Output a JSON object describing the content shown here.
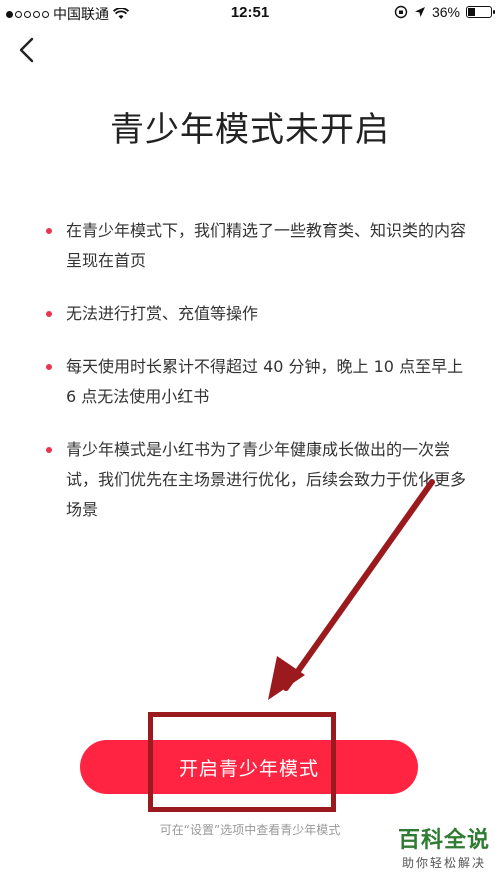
{
  "status_bar": {
    "carrier": "中国联通",
    "time": "12:51",
    "battery": "36%",
    "battery_level": 0.36
  },
  "nav": {
    "back_icon": "chevron-left-icon"
  },
  "title": "青少年模式未开启",
  "info_items": [
    {
      "text": "在青少年模式下，我们精选了一些教育类、知识类的内容呈现在首页"
    },
    {
      "text": "无法进行打赏、充值等操作"
    },
    {
      "text": "每天使用时长累计不得超过 40 分钟，晚上 10 点至早上 6 点无法使用小红书"
    },
    {
      "text": "青少年模式是小红书为了青少年健康成长做出的一次尝试，我们优先在主场景进行优化，后续会致力于优化更多场景"
    }
  ],
  "primary_button": {
    "label": "开启青少年模式"
  },
  "settings_hint": "可在“设置”选项中查看青少年模式",
  "watermark": {
    "main": "百科全说",
    "sub": "助你轻松解决"
  },
  "colors": {
    "accent": "#ff2442",
    "bullet": "#e8374c",
    "annotation": "#9b1a1e"
  }
}
